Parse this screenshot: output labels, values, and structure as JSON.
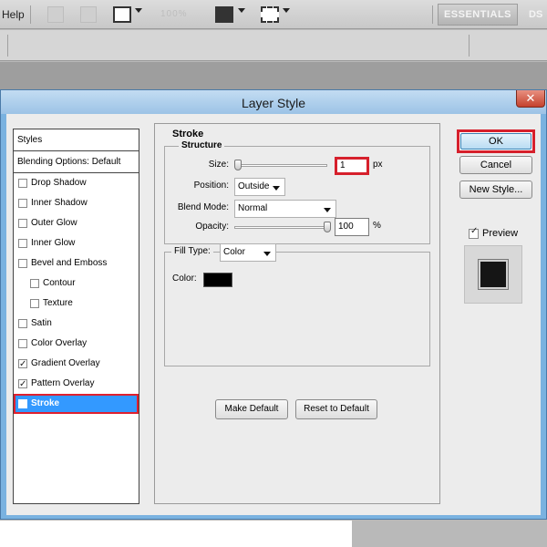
{
  "menubar": {
    "help_label": "Help",
    "zoom_value": "100%",
    "workspace_button": "ESSENTIALS",
    "workspace_next": "DS"
  },
  "dialog": {
    "title": "Layer Style",
    "close_glyph": "✕",
    "styles_list": {
      "header": "Styles",
      "blending_options": "Blending Options: Default",
      "items": [
        {
          "label": "Drop Shadow",
          "checked": false,
          "indent": false
        },
        {
          "label": "Inner Shadow",
          "checked": false,
          "indent": false
        },
        {
          "label": "Outer Glow",
          "checked": false,
          "indent": false
        },
        {
          "label": "Inner Glow",
          "checked": false,
          "indent": false
        },
        {
          "label": "Bevel and Emboss",
          "checked": false,
          "indent": false
        },
        {
          "label": "Contour",
          "checked": false,
          "indent": true
        },
        {
          "label": "Texture",
          "checked": false,
          "indent": true
        },
        {
          "label": "Satin",
          "checked": false,
          "indent": false
        },
        {
          "label": "Color Overlay",
          "checked": false,
          "indent": false
        },
        {
          "label": "Gradient Overlay",
          "checked": true,
          "indent": false
        },
        {
          "label": "Pattern Overlay",
          "checked": true,
          "indent": false
        },
        {
          "label": "Stroke",
          "checked": true,
          "indent": false,
          "selected": true
        }
      ]
    },
    "stroke": {
      "panel_title": "Stroke",
      "structure_title": "Structure",
      "size_label": "Size:",
      "size_value": "1",
      "size_unit": "px",
      "position_label": "Position:",
      "position_value": "Outside",
      "blend_mode_label": "Blend Mode:",
      "blend_mode_value": "Normal",
      "opacity_label": "Opacity:",
      "opacity_value": "100",
      "opacity_unit": "%",
      "fill_type_label": "Fill Type:",
      "fill_type_value": "Color",
      "color_label": "Color:",
      "stroke_color": "#000000",
      "make_default": "Make Default",
      "reset_default": "Reset to Default"
    },
    "buttons": {
      "ok": "OK",
      "cancel": "Cancel",
      "new_style": "New Style...",
      "preview_label": "Preview",
      "preview_checked": true
    }
  },
  "colors": {
    "highlight_red": "#d6202c",
    "selection_blue": "#3399ff",
    "dialog_frame": "#7ab2e0"
  }
}
